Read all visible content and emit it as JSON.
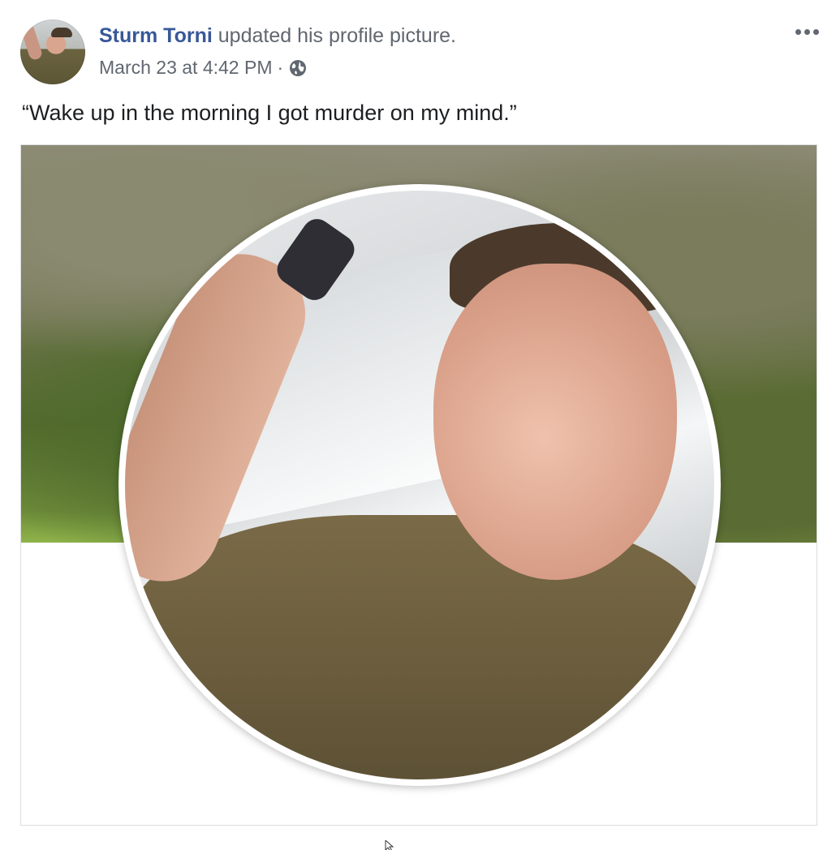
{
  "post": {
    "author": "Sturm Torni",
    "action": "updated his profile picture.",
    "timestamp": "March 23 at 4:42 PM",
    "separator": "·",
    "privacy_icon": "globe-icon",
    "more_icon": "more-options-icon",
    "caption": "“Wake up in the morning I got murder on my mind.”"
  },
  "colors": {
    "author_link": "#385898",
    "secondary_text": "#606770",
    "body_text": "#1c1e21",
    "border": "#dadde1"
  }
}
